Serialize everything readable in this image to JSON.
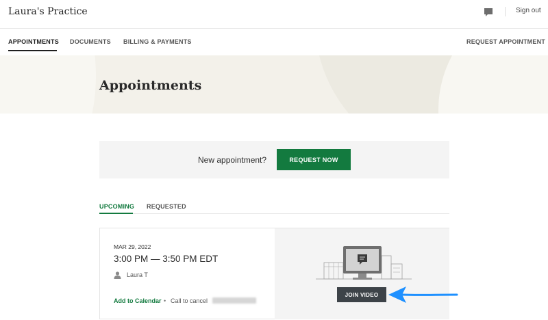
{
  "header": {
    "brand": "Laura's Practice",
    "sign_out": "Sign out"
  },
  "nav": {
    "items": [
      "APPOINTMENTS",
      "DOCUMENTS",
      "BILLING & PAYMENTS"
    ],
    "active": "APPOINTMENTS",
    "request_appointment": "REQUEST APPOINTMENT"
  },
  "hero": {
    "title": "Appointments"
  },
  "new_appointment": {
    "prompt": "New appointment?",
    "button": "REQUEST NOW"
  },
  "tabs": {
    "upcoming": "UPCOMING",
    "requested": "REQUESTED",
    "active": "UPCOMING"
  },
  "appointment": {
    "date": "MAR 29, 2022",
    "time": "3:00 PM — 3:50 PM EDT",
    "person": "Laura T",
    "add_to_calendar": "Add to Calendar",
    "separator": "•",
    "call_to_cancel": "Call to cancel",
    "join_video": "JOIN VIDEO"
  },
  "icons": {
    "messages": "chat-bubble-icon",
    "person": "person-icon",
    "illustration": "video-computer-illustration",
    "annotation": "blue-arrow-pointer"
  },
  "colors": {
    "brand_green": "#137a3f",
    "hero_background": "#f3f1ea",
    "join_button": "#3d4348",
    "annotation_arrow": "#1e90ff"
  }
}
